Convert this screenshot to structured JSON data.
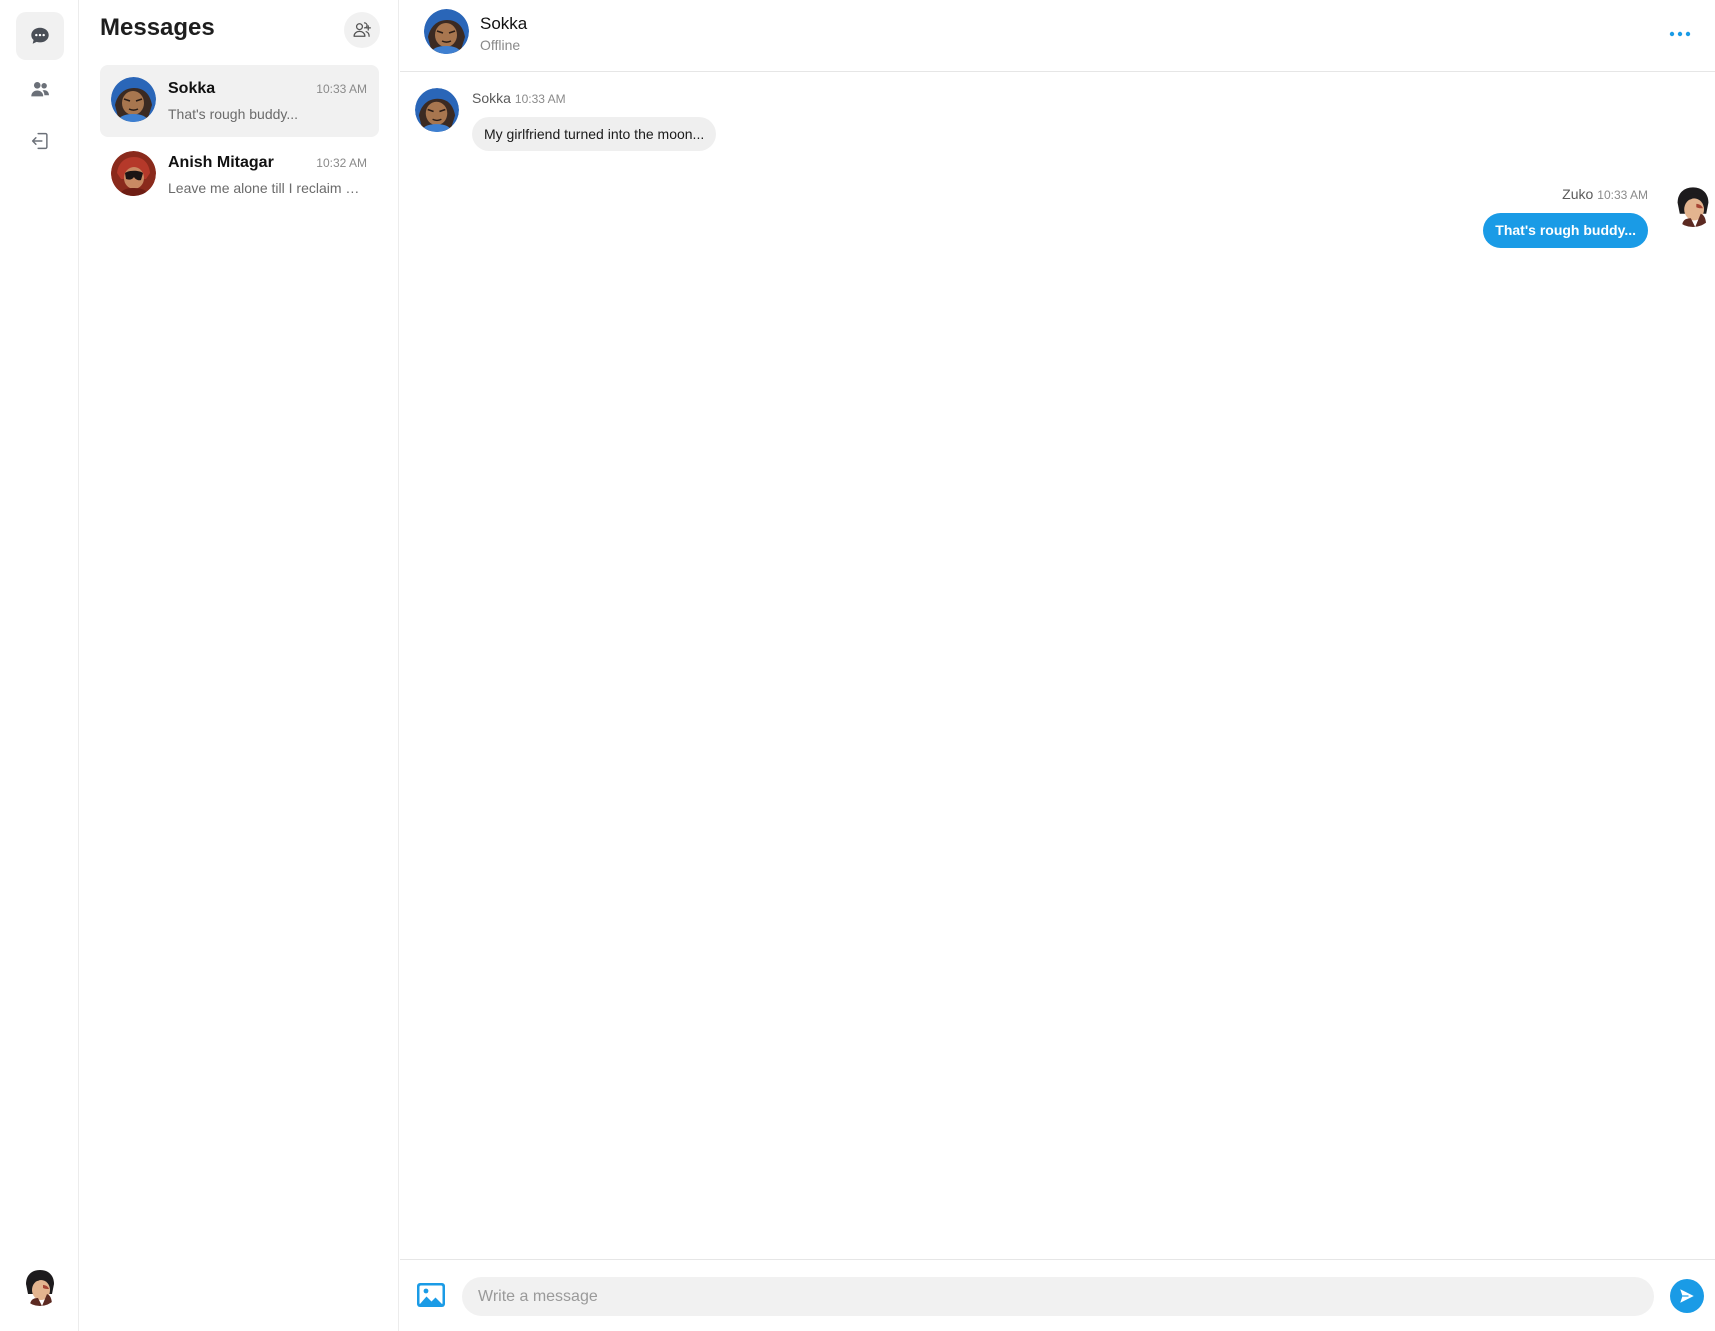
{
  "colors": {
    "accent": "#1a9be6",
    "active_bg": "#f1f1f1"
  },
  "rail": {
    "items": [
      {
        "icon": "chat-bubble-icon",
        "active": true
      },
      {
        "icon": "contacts-icon",
        "active": false
      },
      {
        "icon": "logout-icon",
        "active": false
      }
    ],
    "user_avatar": "zuko-avatar"
  },
  "list": {
    "title": "Messages",
    "add_icon": "add-user-icon",
    "conversations": [
      {
        "name": "Sokka",
        "time": "10:33 AM",
        "preview": "That's rough buddy...",
        "active": true
      },
      {
        "name": "Anish Mitagar",
        "time": "10:32 AM",
        "preview": "Leave me alone till I reclaim my honor",
        "active": false
      }
    ]
  },
  "chat": {
    "contact_name": "Sokka",
    "contact_status": "Offline",
    "messages": [
      {
        "sender": "Sokka",
        "time": "10:33 AM",
        "text": "My girlfriend turned into the moon...",
        "direction": "in"
      },
      {
        "sender": "Zuko",
        "time": "10:33 AM",
        "text": "That's rough buddy...",
        "direction": "out"
      }
    ],
    "composer": {
      "placeholder": "Write a message"
    }
  }
}
